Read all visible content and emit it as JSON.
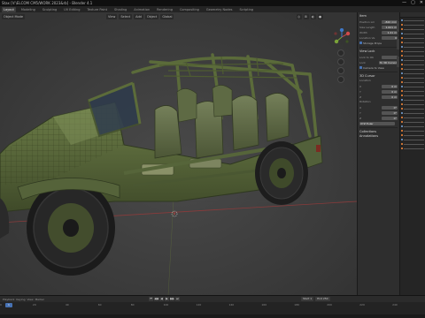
{
  "window": {
    "title": "Stax [V:\\ELCOM CM5/WORK 2023&rb] - Blender 4.1",
    "minimize": "—",
    "maximize": "▢",
    "close": "✕"
  },
  "menu": {
    "tabs": [
      "Layout",
      "Modeling",
      "Sculpting",
      "UV Editing",
      "Texture Paint",
      "Shading",
      "Animation",
      "Rendering",
      "Compositing",
      "Geometry Nodes",
      "Scripting"
    ],
    "active_index": 0
  },
  "viewport": {
    "mode": "Object Mode",
    "view_menus": [
      "View",
      "Select",
      "Add",
      "Object"
    ],
    "shading": "Global",
    "overlay_icons": [
      "◎",
      "⊞",
      "◐",
      "●"
    ]
  },
  "npanel": {
    "header": "Item",
    "rows_top": [
      {
        "label": "Position Lm",
        "value": "-820 mm"
      },
      {
        "label": "Size Length",
        "value": "1.621 m"
      },
      {
        "label": "Width",
        "value": "1.41 m"
      }
    ],
    "row_loc": {
      "label": "Location Ve",
      "value": "0"
    },
    "check_label": "Storage Props",
    "view_head": "View Lock",
    "view_rows": [
      {
        "label": "Lock to Ob",
        "value": ""
      },
      {
        "label": "Lock",
        "value": "To 3D Cursor"
      }
    ],
    "camera_check": "Camera to View",
    "cursor_head": "3D Cursor",
    "loc_head": "Location",
    "loc_rows": [
      {
        "label": "X",
        "value": "0 m"
      },
      {
        "label": "Y",
        "value": "0 m"
      },
      {
        "label": "Z",
        "value": "0 m"
      }
    ],
    "rot_head": "Rotation",
    "rot_rows": [
      {
        "label": "X",
        "value": "0°"
      },
      {
        "label": "Y",
        "value": "0°"
      },
      {
        "label": "Z",
        "value": "0°"
      }
    ],
    "mode_value": "XYZ Euler",
    "collections_head": "Collections",
    "annotations_head": "Annotations"
  },
  "timeline": {
    "menus": [
      "Playback",
      "Keying",
      "View",
      "Marker"
    ],
    "controls": [
      "⏮",
      "◀◀",
      "◀",
      "▶",
      "▶▶",
      "⏭"
    ],
    "start_label": "Start 1",
    "end_label": "End 250",
    "current_frame": "1",
    "ticks": [
      "0",
      "20",
      "40",
      "60",
      "80",
      "100",
      "120",
      "140",
      "160",
      "180",
      "200",
      "220",
      "240"
    ]
  }
}
